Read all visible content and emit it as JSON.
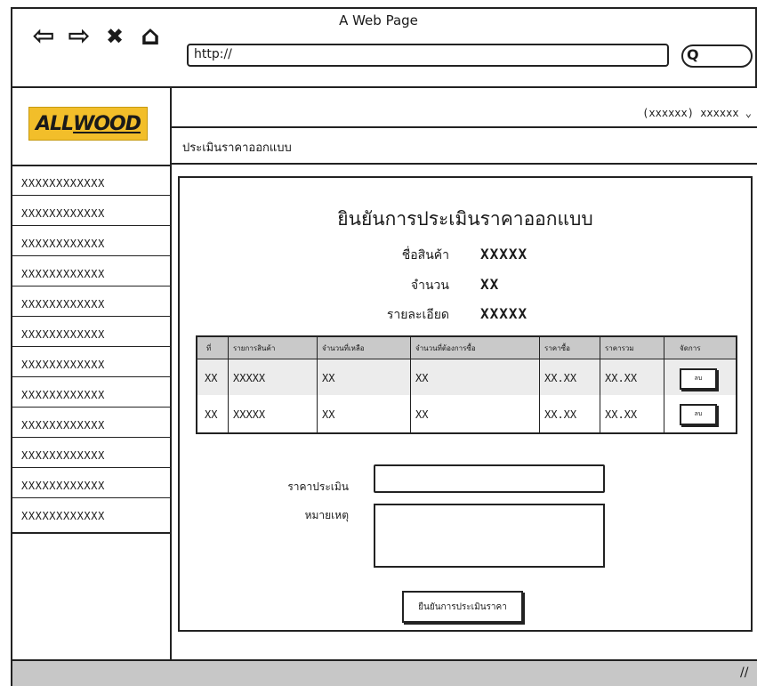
{
  "browser": {
    "title": "A Web Page",
    "url": "http://",
    "back_icon": "⇦",
    "forward_icon": "⇨",
    "stop_icon": "✖",
    "home_icon": "⌂",
    "search_icon": "Q"
  },
  "logo": {
    "prefix": "ALL",
    "suffix": "WOOD"
  },
  "sidebar": {
    "items": [
      {
        "label": "XXXXXXXXXXXX"
      },
      {
        "label": "XXXXXXXXXXXX"
      },
      {
        "label": "XXXXXXXXXXXX"
      },
      {
        "label": "XXXXXXXXXXXX"
      },
      {
        "label": "XXXXXXXXXXXX"
      },
      {
        "label": "XXXXXXXXXXXX"
      },
      {
        "label": "XXXXXXXXXXXX"
      },
      {
        "label": "XXXXXXXXXXXX"
      },
      {
        "label": "XXXXXXXXXXXX"
      },
      {
        "label": "XXXXXXXXXXXX"
      },
      {
        "label": "XXXXXXXXXXXX"
      },
      {
        "label": "XXXXXXXXXXXX"
      }
    ]
  },
  "header": {
    "user_menu": "(xxxxxx) xxxxxx ⌄",
    "breadcrumb": "ประเมินราคาออกแบบ"
  },
  "main": {
    "title": "ยินยันการประเมินราคาออกแบบ",
    "info": [
      {
        "label": "ชื่อสินค้า",
        "value": "XXXXX"
      },
      {
        "label": "จำนวน",
        "value": "XX"
      },
      {
        "label": "รายละเอียด",
        "value": "XXXXX"
      }
    ]
  },
  "table": {
    "headers": [
      "ที่",
      "รายการสินค้า",
      "จำนวนที่เหลือ",
      "จำนวนที่ต้องการซื้อ",
      "ราคาซื้อ",
      "ราคารวม",
      "จัดการ"
    ],
    "rows": [
      {
        "no": "XX",
        "item": "XXXXX",
        "remaining": "XX",
        "wanted": "XX",
        "price": "XX.XX",
        "total": "XX.XX",
        "action": "ลบ"
      },
      {
        "no": "XX",
        "item": "XXXXX",
        "remaining": "XX",
        "wanted": "XX",
        "price": "XX.XX",
        "total": "XX.XX",
        "action": "ลบ"
      }
    ]
  },
  "form": {
    "price_label": "ราคาประเมิน",
    "price_value": "",
    "note_label": "หมายเหตุ",
    "note_value": "",
    "confirm_label": "ยืนยันการประเมินราคา"
  }
}
